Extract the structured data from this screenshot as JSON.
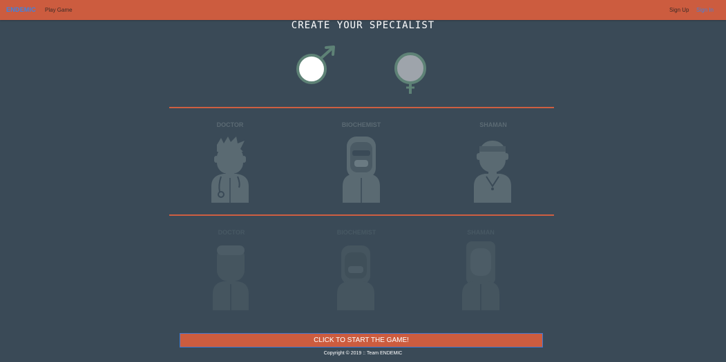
{
  "nav": {
    "brand": "ENDEMIC",
    "play_game": "Play Game",
    "sign_up": "Sign Up",
    "sign_in": "Sign In"
  },
  "page": {
    "title": "CREATE YOUR SPECIALIST"
  },
  "genders": [
    {
      "name": "male",
      "icon": "male-icon",
      "selected": true
    },
    {
      "name": "female",
      "icon": "female-icon",
      "selected": false
    }
  ],
  "specialists_male": [
    {
      "label": "DOCTOR",
      "icon": "doctor-avatar-icon"
    },
    {
      "label": "BIOCHEMIST",
      "icon": "biochemist-avatar-icon"
    },
    {
      "label": "SHAMAN",
      "icon": "shaman-avatar-icon"
    }
  ],
  "specialists_female": [
    {
      "label": "DOCTOR",
      "icon": "doctor-avatar-icon"
    },
    {
      "label": "BIOCHEMIST",
      "icon": "biochemist-avatar-icon"
    },
    {
      "label": "SHAMAN",
      "icon": "shaman-avatar-icon"
    }
  ],
  "start_button": "CLICK TO START THE GAME!",
  "footer": "Copyright © 2019 :: Team ENDEMIC",
  "colors": {
    "background": "#3a4a57",
    "accent": "#cc5c3f",
    "link": "#3b83e6",
    "avatar": "#5a6a72"
  }
}
